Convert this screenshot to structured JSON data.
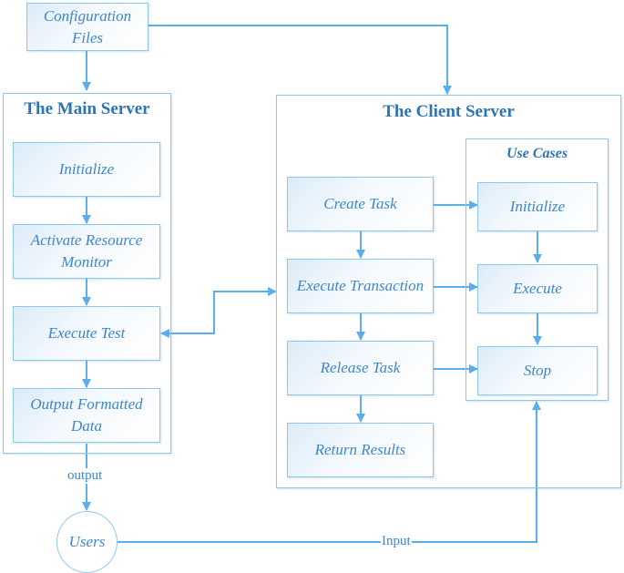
{
  "diagram": {
    "config_files": "Configuration Files",
    "main_server": {
      "title": "The Main Server",
      "steps": [
        "Initialize",
        "Activate Resource Monitor",
        "Execute Test",
        "Output Formatted Data"
      ]
    },
    "client_server": {
      "title": "The Client Server",
      "steps": [
        "Create Task",
        "Execute Transaction",
        "Release Task",
        "Return Results"
      ],
      "use_cases": {
        "title": "Use Cases",
        "steps": [
          "Initialize",
          "Execute",
          "Stop"
        ]
      }
    },
    "users": "Users",
    "edge_labels": {
      "output": "output",
      "input": "Input"
    },
    "colors": {
      "line": "#5aaeee",
      "border": "#8cc8ea",
      "text": "#3d86cc",
      "title": "#2e74b5"
    }
  }
}
